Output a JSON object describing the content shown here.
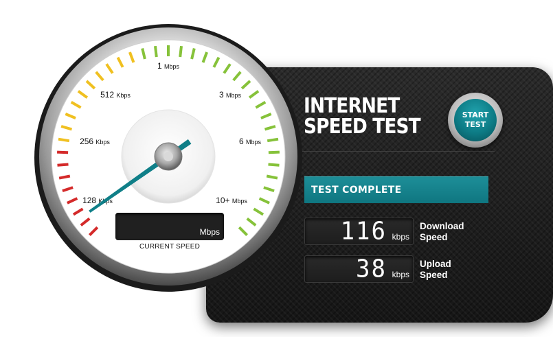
{
  "title": {
    "line1": "INTERNET",
    "line2": "SPEED TEST"
  },
  "start_button": {
    "line1": "START",
    "line2": "TEST"
  },
  "status": "TEST COMPLETE",
  "download": {
    "value": "116",
    "unit": "kbps",
    "label_line1": "Download",
    "label_line2": "Speed"
  },
  "upload": {
    "value": "38",
    "unit": "kbps",
    "label_line1": "Upload",
    "label_line2": "Speed"
  },
  "gauge": {
    "labels": [
      {
        "key": "l128",
        "text": "128 Kbps"
      },
      {
        "key": "l256",
        "text": "256 Kbps"
      },
      {
        "key": "l512",
        "text": "512 Kbps"
      },
      {
        "key": "l1m",
        "text": "1 Mbps"
      },
      {
        "key": "l3m",
        "text": "3 Mbps"
      },
      {
        "key": "l6m",
        "text": "6 Mbps"
      },
      {
        "key": "l10m",
        "text": "10+ Mbps"
      }
    ],
    "current_speed_value": "",
    "current_speed_unit": "Mbps",
    "current_speed_label": "CURRENT SPEED",
    "tick_colors": {
      "red": "#d42a2a",
      "yellow": "#f0c020",
      "green": "#86c23a"
    },
    "needle_color": "#0f7f88"
  }
}
